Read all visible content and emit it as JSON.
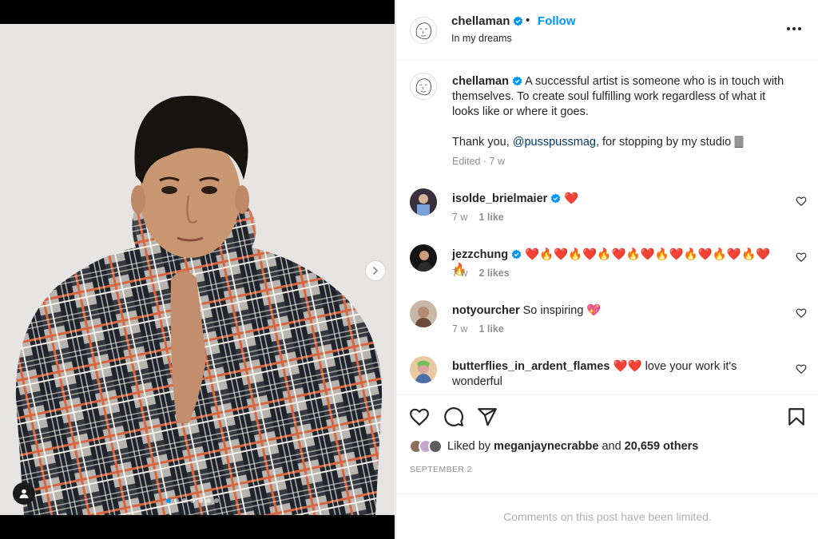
{
  "post": {
    "username": "chellaman",
    "follow_label": "Follow",
    "separator": "•",
    "location": "In my dreams",
    "verified": true
  },
  "media": {
    "slide_count": 7,
    "active_slide": 1
  },
  "caption": {
    "username": "chellaman",
    "text": "A successful artist is someone who is in touch with themselves. To create soul fulfilling work regardless of what it looks like or where it goes.",
    "thanks_prefix": "Thank you, ",
    "mention": "@pusspussmag",
    "thanks_suffix": ", for stopping by my studio 🀫",
    "meta": "Edited · 7 w"
  },
  "comments": [
    {
      "username": "isolde_brielmaier",
      "verified": true,
      "text": "❤️",
      "time": "7 w",
      "likes": "1 like"
    },
    {
      "username": "jezzchung",
      "verified": true,
      "text": "❤️🔥❤️🔥❤️🔥❤️🔥❤️🔥❤️🔥❤️🔥❤️🔥❤️🔥",
      "time": "7 w",
      "likes": "2 likes"
    },
    {
      "username": "notyourcher",
      "verified": false,
      "text": "So inspiring 💖",
      "time": "7 w",
      "likes": "1 like"
    },
    {
      "username": "butterflies_in_ardent_flames",
      "verified": false,
      "text": "❤️❤️ love your work it's wonderful",
      "time": "",
      "likes": ""
    }
  ],
  "likes": {
    "prefix": "Liked by ",
    "user": "meganjaynecrabbe",
    "middle": " and ",
    "count": "20,659 others"
  },
  "date": "SEPTEMBER 2",
  "comments_limited": "Comments on this post have been limited.",
  "colors": {
    "accent": "#0095f6",
    "mention": "#00376b",
    "muted": "#8e8e8e",
    "text": "#262626"
  },
  "icons": {
    "like": "heart-icon",
    "comment": "comment-icon",
    "share": "paper-plane-icon",
    "save": "bookmark-icon",
    "more": "more-horizontal-icon",
    "next": "chevron-right-icon",
    "tags": "user-tag-icon",
    "verified": "verified-badge-icon"
  }
}
